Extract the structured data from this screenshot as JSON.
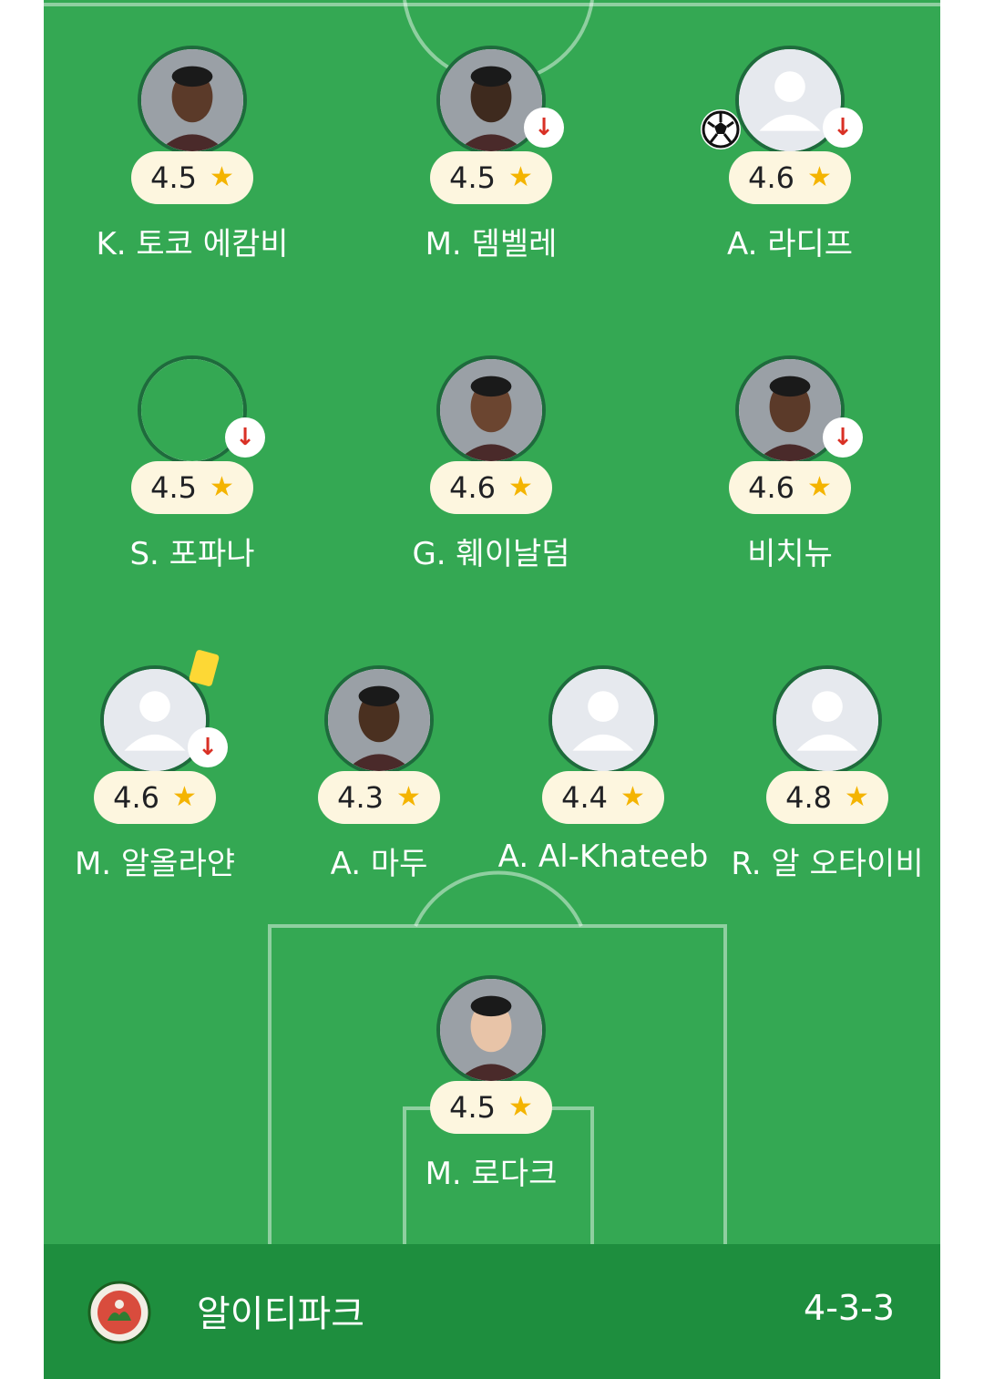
{
  "players": [
    {
      "name": "K. 토코 에캄비",
      "rating": "4.5",
      "star": "★",
      "avatar": "player-photo"
    },
    {
      "name": "M. 뎀벨레",
      "rating": "4.5",
      "star": "★",
      "avatar": "player-photo",
      "substituted": true,
      "sub_glyph": "↓"
    },
    {
      "name": "A. 라디프",
      "rating": "4.6",
      "star": "★",
      "avatar": "placeholder",
      "substituted": true,
      "sub_glyph": "↓",
      "goal": true
    },
    {
      "name": "S. 포파나",
      "rating": "4.5",
      "star": "★",
      "avatar": "empty",
      "substituted": true,
      "sub_glyph": "↓"
    },
    {
      "name": "G. 훼이날덤",
      "rating": "4.6",
      "star": "★",
      "avatar": "player-photo"
    },
    {
      "name": "비치뉴",
      "rating": "4.6",
      "star": "★",
      "avatar": "player-photo",
      "substituted": true,
      "sub_glyph": "↓"
    },
    {
      "name": "M. 알올라얀",
      "rating": "4.6",
      "star": "★",
      "avatar": "placeholder",
      "substituted": true,
      "sub_glyph": "↓",
      "yellow_card": true
    },
    {
      "name": "A. 마두",
      "rating": "4.3",
      "star": "★",
      "avatar": "player-photo"
    },
    {
      "name": "A. Al-Khateeb",
      "rating": "4.4",
      "star": "★",
      "avatar": "placeholder"
    },
    {
      "name": "R. 알 오타이비",
      "rating": "4.8",
      "star": "★",
      "avatar": "placeholder"
    },
    {
      "name": "M. 로다크",
      "rating": "4.5",
      "star": "★",
      "avatar": "player-photo"
    }
  ],
  "team": {
    "name": "알이티파크",
    "formation": "4-3-3",
    "logo": "club-crest-icon"
  },
  "colors": {
    "pitch": "#34a853",
    "footer": "#1e8e3e",
    "rating_bg": "#fdf6df",
    "star": "#f4b400",
    "sub_arrow": "#d93025",
    "avatar_ring": "#1e6b3c"
  }
}
